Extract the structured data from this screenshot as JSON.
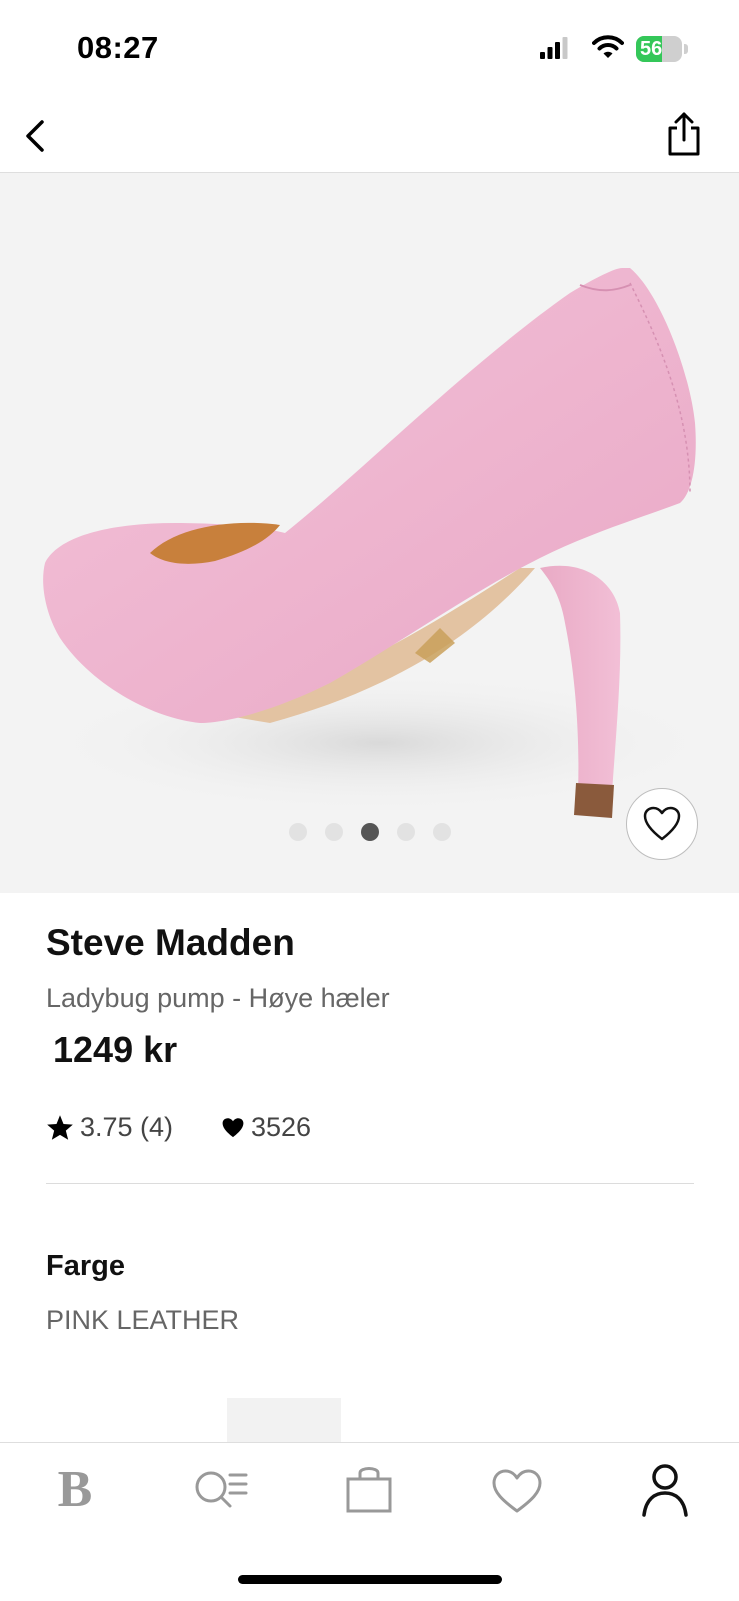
{
  "status_bar": {
    "time": "08:27",
    "battery_percent": "56",
    "battery_level": 0.56,
    "battery_color": "#34c759"
  },
  "nav": {
    "back_icon": "chevron-left-icon",
    "share_icon": "share-icon"
  },
  "gallery": {
    "image_description_icon": "product-photo",
    "slide_count": 5,
    "active_slide": 3,
    "favorite_icon": "heart-outline-icon"
  },
  "product": {
    "brand": "Steve Madden",
    "name": "Ladybug pump - Høye hæler",
    "price": "1249 kr",
    "rating": "3.75 (4)",
    "likes": "3526"
  },
  "color_section": {
    "label": "Farge",
    "value": "PINK LEATHER"
  },
  "tab_bar": {
    "home_label": "B",
    "icons": [
      "b-logo-icon",
      "search-list-icon",
      "shopping-bag-icon",
      "heart-icon",
      "profile-icon"
    ],
    "active_tab": "profile"
  }
}
